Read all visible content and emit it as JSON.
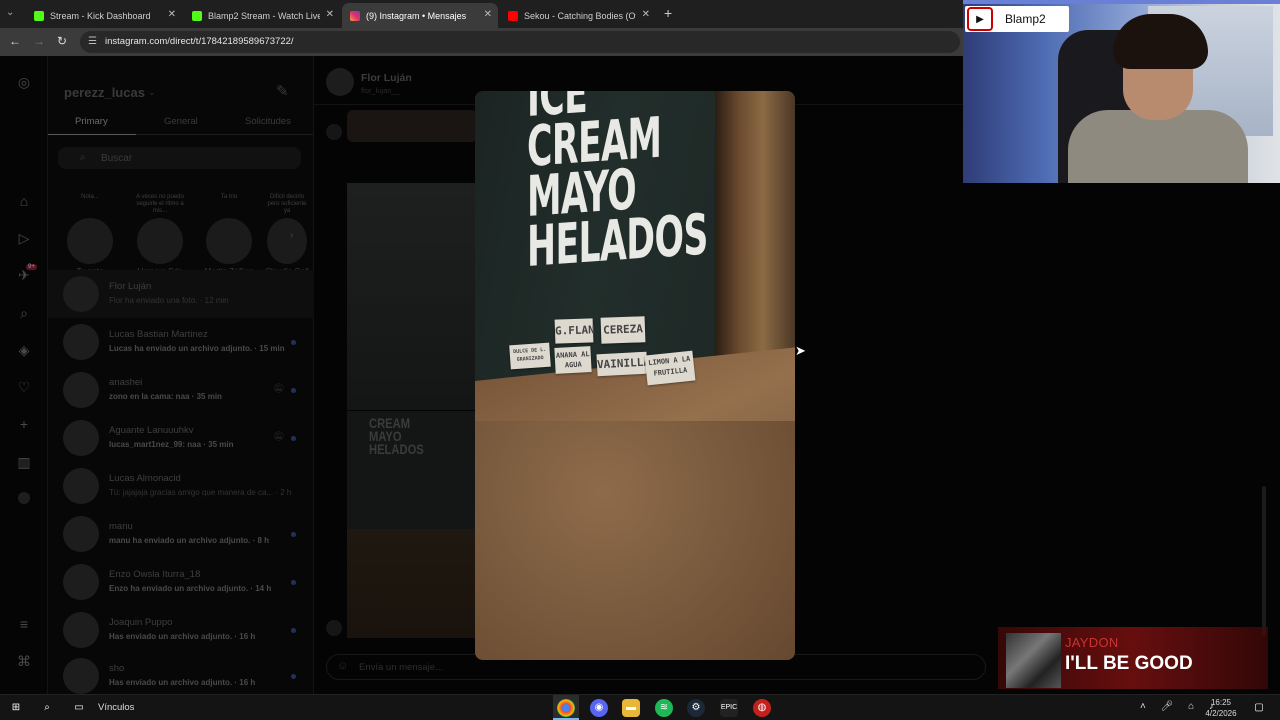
{
  "browser": {
    "tabs": [
      {
        "title": "Stream - Kick Dashboard",
        "icon": "kick-icon",
        "color": "#53fc18"
      },
      {
        "title": "Blamp2 Stream - Watch Live on",
        "icon": "kick-icon",
        "color": "#53fc18"
      },
      {
        "title": "(9) Instagram • Mensajes",
        "icon": "instagram-icon",
        "color": "#e1306c",
        "active": true
      },
      {
        "title": "Sekou - Catching Bodies (Offici",
        "icon": "youtube-icon",
        "color": "#ff0000"
      }
    ],
    "url": "instagram.com/direct/t/17842189589673722/"
  },
  "instagram": {
    "username": "perezz_lucas",
    "inbox_tabs": [
      "Primary",
      "General",
      "Solicitudes"
    ],
    "search_placeholder": "Buscar",
    "notes": [
      {
        "bubble": "Nota...",
        "name": "Tu nota"
      },
      {
        "bubble": "A veces no puedo seguirle el ritmo a mis...",
        "name": "Homero Sdp"
      },
      {
        "bubble": "Ta trio",
        "name": "Martin Zúñiga"
      },
      {
        "bubble": "Difícil decirlo pero suficiente ya",
        "name": "Claudio Gall"
      }
    ],
    "rail_badge": "9+",
    "conversations": [
      {
        "name": "Flor Luján",
        "preview": "Flor ha enviado una foto. · 12 min",
        "selected": true
      },
      {
        "name": "Lucas Bastian Martinez",
        "preview": "Lucas ha enviado un archivo adjunto. · 15 min",
        "unread": true
      },
      {
        "name": "anashei",
        "preview": "zono en la cama: naa · 35 min",
        "muted": true
      },
      {
        "name": "Aguante Lanuuuhkv",
        "preview": "lucas_mart1nez_99: naa · 35 min",
        "muted": true
      },
      {
        "name": "Lucas Almonacid",
        "preview": "Tú: jajajaja gracias amigo que manera de ca... · 2 h"
      },
      {
        "name": "manu",
        "preview": "manu ha enviado un archivo adjunto. · 8 h",
        "unread": true
      },
      {
        "name": "Enzo Owsla Iturra_18",
        "preview": "Enzo ha enviado un archivo adjunto. · 14 h",
        "unread": true
      },
      {
        "name": "Joaquin Puppo",
        "preview": "Has enviado un archivo adjunto. · 16 h",
        "unread": true
      },
      {
        "name": "sho",
        "preview": "Has enviado un archivo adjunto. · 16 h",
        "unread": true
      }
    ],
    "chat": {
      "name": "Flor Luján",
      "handle": "flor_lujan__",
      "input_placeholder": "Envía un mensaje..."
    },
    "photo": {
      "sign_lines": [
        "ICE",
        "CREAM",
        "MAYO",
        "HELADOS"
      ],
      "flavors": [
        "G.FLAN",
        "CEREZA",
        "DULCE DE L. GRANIZADO",
        "ANANA AL AGUA",
        "VAINILLA",
        "LIMON A LA FRUTILLA"
      ]
    }
  },
  "overlays": {
    "channel_name": "Blamp2",
    "now_playing_artist": "JAYDON",
    "now_playing_title": "I'LL BE GOOD"
  },
  "taskbar": {
    "links_label": "Vínculos",
    "time": "16:25",
    "date": "4/2/2026"
  }
}
